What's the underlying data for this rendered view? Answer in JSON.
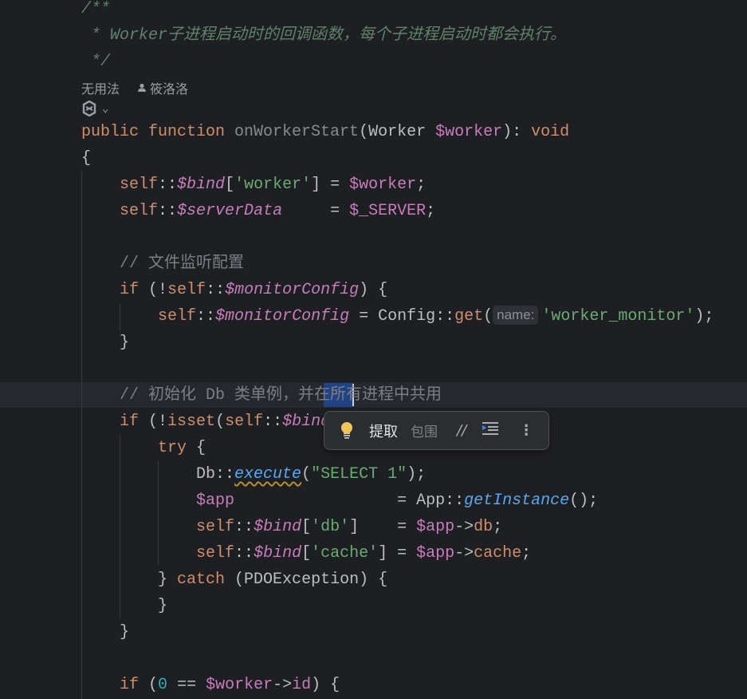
{
  "colors": {
    "background": "#1e1f22",
    "keyword": "#cf8e6d",
    "variable": "#c77dbb",
    "string": "#6aab73",
    "comment": "#7a7e85",
    "doc_comment": "#5f826b",
    "selection": "#214283",
    "number": "#2aacb8"
  },
  "doc_comment": [
    "/**",
    " * Worker子进程启动时的回调函数，每个子进程启动时都会执行。",
    " */"
  ],
  "code_vision": {
    "usages": "无用法",
    "author": "筱洛洛",
    "author_icon": "person-icon",
    "ai_icon": "ai-assistant-icon"
  },
  "code_lines": [
    [
      [
        "public function ",
        "kw"
      ],
      [
        "onWorkerStart",
        "unused"
      ],
      [
        "(Worker ",
        "plain"
      ],
      [
        "$worker",
        "var"
      ],
      [
        "): ",
        "plain"
      ],
      [
        "void",
        "kw"
      ]
    ],
    [
      [
        "{",
        "plain"
      ]
    ],
    [
      [
        "    ",
        "plain"
      ],
      [
        "self",
        "kw"
      ],
      [
        "::",
        "plain"
      ],
      [
        "$bind",
        "svar"
      ],
      [
        "[",
        "plain"
      ],
      [
        "'worker'",
        "str"
      ],
      [
        "] = ",
        "plain"
      ],
      [
        "$worker",
        "var"
      ],
      [
        ";",
        "plain"
      ]
    ],
    [
      [
        "    ",
        "plain"
      ],
      [
        "self",
        "kw"
      ],
      [
        "::",
        "plain"
      ],
      [
        "$serverData",
        "svar"
      ],
      [
        "     = ",
        "plain"
      ],
      [
        "$_SERVER",
        "var"
      ],
      [
        ";",
        "plain"
      ]
    ],
    [],
    [
      [
        "    ",
        "plain"
      ],
      [
        "// 文件监听配置",
        "cm"
      ]
    ],
    [
      [
        "    ",
        "plain"
      ],
      [
        "if",
        "kw"
      ],
      [
        " (!",
        "plain"
      ],
      [
        "self",
        "kw"
      ],
      [
        "::",
        "plain"
      ],
      [
        "$monitorConfig",
        "svar"
      ],
      [
        ") {",
        "plain"
      ]
    ],
    [
      [
        "        ",
        "plain"
      ],
      [
        "self",
        "kw"
      ],
      [
        "::",
        "plain"
      ],
      [
        "$monitorConfig",
        "svar"
      ],
      [
        " = Config::",
        "plain"
      ],
      [
        "get",
        "prop"
      ],
      [
        "(",
        "plain"
      ],
      [
        "name:",
        "hint"
      ],
      [
        "'worker_monitor'",
        "str"
      ],
      [
        ");",
        "plain"
      ]
    ],
    [
      [
        "    }",
        "plain"
      ]
    ],
    [],
    [
      [
        "    ",
        "plain"
      ],
      [
        "// 初始化 Db 类单例，并在所有进程中共用",
        "cm"
      ]
    ],
    [
      [
        "    ",
        "plain"
      ],
      [
        "if",
        "kw"
      ],
      [
        " (!",
        "plain"
      ],
      [
        "isset",
        "kw"
      ],
      [
        "(",
        "plain"
      ],
      [
        "self",
        "kw"
      ],
      [
        "::",
        "plain"
      ],
      [
        "$bind",
        "svar"
      ]
    ],
    [
      [
        "        ",
        "plain"
      ],
      [
        "try",
        "kw"
      ],
      [
        " {",
        "plain"
      ]
    ],
    [
      [
        "            Db::",
        "plain"
      ],
      [
        "execute",
        "warn"
      ],
      [
        "(",
        "plain"
      ],
      [
        "\"SELECT 1\"",
        "str"
      ],
      [
        ");",
        "plain"
      ]
    ],
    [
      [
        "            ",
        "plain"
      ],
      [
        "$app",
        "var"
      ],
      [
        "                 = App::",
        "plain"
      ],
      [
        "getInstance",
        "smeth"
      ],
      [
        "();",
        "plain"
      ]
    ],
    [
      [
        "            ",
        "plain"
      ],
      [
        "self",
        "kw"
      ],
      [
        "::",
        "plain"
      ],
      [
        "$bind",
        "svar"
      ],
      [
        "[",
        "plain"
      ],
      [
        "'db'",
        "str"
      ],
      [
        "]    = ",
        "plain"
      ],
      [
        "$app",
        "var"
      ],
      [
        "->",
        "plain"
      ],
      [
        "db",
        "prop"
      ],
      [
        ";",
        "plain"
      ]
    ],
    [
      [
        "            ",
        "plain"
      ],
      [
        "self",
        "kw"
      ],
      [
        "::",
        "plain"
      ],
      [
        "$bind",
        "svar"
      ],
      [
        "[",
        "plain"
      ],
      [
        "'cache'",
        "str"
      ],
      [
        "] = ",
        "plain"
      ],
      [
        "$app",
        "var"
      ],
      [
        "->",
        "plain"
      ],
      [
        "cache",
        "prop"
      ],
      [
        ";",
        "plain"
      ]
    ],
    [
      [
        "        } ",
        "plain"
      ],
      [
        "catch",
        "kw"
      ],
      [
        " (PDOException) {",
        "plain"
      ]
    ],
    [
      [
        "        }",
        "plain"
      ]
    ],
    [
      [
        "    }",
        "plain"
      ]
    ],
    [],
    [
      [
        "    ",
        "plain"
      ],
      [
        "if",
        "kw"
      ],
      [
        " (",
        "plain"
      ],
      [
        "0",
        "num"
      ],
      [
        " == ",
        "plain"
      ],
      [
        "$worker",
        "var"
      ],
      [
        "->",
        "plain"
      ],
      [
        "id",
        "pprop"
      ],
      [
        ") {",
        "plain"
      ]
    ]
  ],
  "intention_popup": {
    "bulb_icon": "lightbulb-icon",
    "extract": "提取",
    "surround": "包围",
    "comment_icon": "comment-toggle-icon",
    "format_icon": "reformat-icon",
    "more_icon": "more-vertical-icon"
  }
}
